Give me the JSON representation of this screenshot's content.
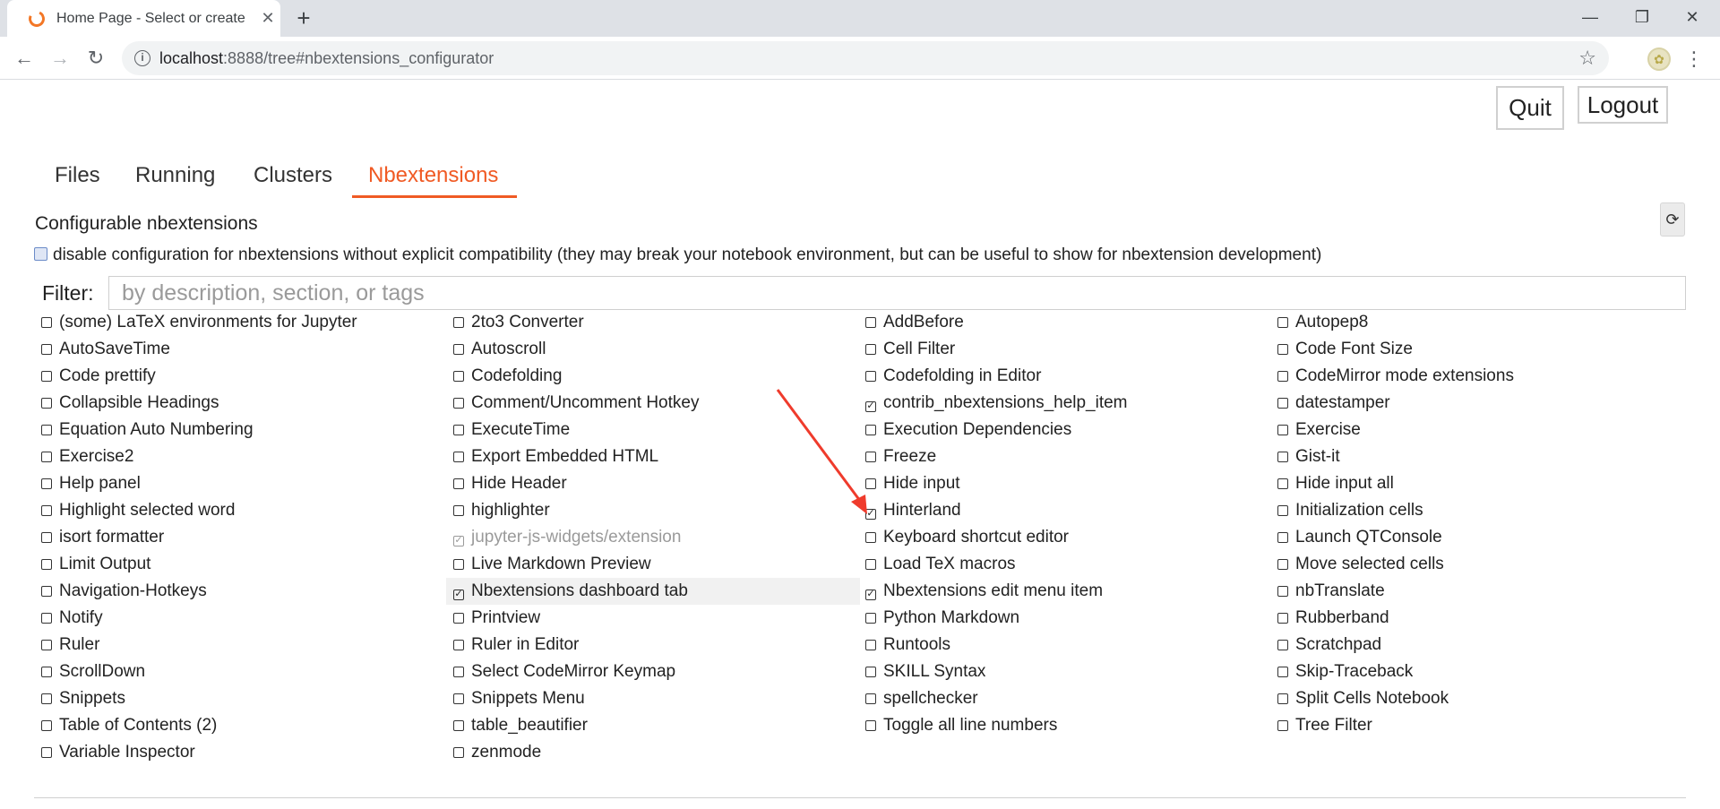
{
  "browser": {
    "tab_title": "Home Page - Select or create a",
    "tab_close": "✕",
    "new_tab": "+",
    "win_minimize": "—",
    "win_restore": "❐",
    "win_close": "✕",
    "url_host": "localhost",
    "url_rest": ":8888/tree#nbextensions_configurator",
    "back": "←",
    "forward": "→",
    "reload": "↻",
    "star": "☆",
    "menu": "⋮",
    "info": "i"
  },
  "header": {
    "quit_label": "Quit",
    "logout_label": "Logout"
  },
  "tabs": [
    {
      "label": "Files"
    },
    {
      "label": "Running"
    },
    {
      "label": "Clusters"
    },
    {
      "label": "Nbextensions"
    }
  ],
  "configurator": {
    "title": "Configurable nbextensions",
    "refresh_icon": "⟳",
    "compat_label": "disable configuration for nbextensions without explicit compatibility (they may break your notebook environment, but can be useful to show for nbextension development)",
    "filter_label": "Filter:",
    "filter_placeholder": "by description, section, or tags"
  },
  "extensions": {
    "columns": [
      [
        {
          "name": "(some) LaTeX environments for Jupyter",
          "checked": false
        },
        {
          "name": "AutoSaveTime",
          "checked": false
        },
        {
          "name": "Code prettify",
          "checked": false
        },
        {
          "name": "Collapsible Headings",
          "checked": false
        },
        {
          "name": "Equation Auto Numbering",
          "checked": false
        },
        {
          "name": "Exercise2",
          "checked": false
        },
        {
          "name": "Help panel",
          "checked": false
        },
        {
          "name": "Highlight selected word",
          "checked": false
        },
        {
          "name": "isort formatter",
          "checked": false
        },
        {
          "name": "Limit Output",
          "checked": false
        },
        {
          "name": "Navigation-Hotkeys",
          "checked": false
        },
        {
          "name": "Notify",
          "checked": false
        },
        {
          "name": "Ruler",
          "checked": false
        },
        {
          "name": "ScrollDown",
          "checked": false
        },
        {
          "name": "Snippets",
          "checked": false
        },
        {
          "name": "Table of Contents (2)",
          "checked": false
        },
        {
          "name": "Variable Inspector",
          "checked": false
        }
      ],
      [
        {
          "name": "2to3 Converter",
          "checked": false
        },
        {
          "name": "Autoscroll",
          "checked": false
        },
        {
          "name": "Codefolding",
          "checked": false
        },
        {
          "name": "Comment/Uncomment Hotkey",
          "checked": false
        },
        {
          "name": "ExecuteTime",
          "checked": false
        },
        {
          "name": "Export Embedded HTML",
          "checked": false
        },
        {
          "name": "Hide Header",
          "checked": false
        },
        {
          "name": "highlighter",
          "checked": false
        },
        {
          "name": "jupyter-js-widgets/extension",
          "checked": true,
          "dim": true
        },
        {
          "name": "Live Markdown Preview",
          "checked": false
        },
        {
          "name": "Nbextensions dashboard tab",
          "checked": true,
          "highlight": true
        },
        {
          "name": "Printview",
          "checked": false
        },
        {
          "name": "Ruler in Editor",
          "checked": false
        },
        {
          "name": "Select CodeMirror Keymap",
          "checked": false
        },
        {
          "name": "Snippets Menu",
          "checked": false
        },
        {
          "name": "table_beautifier",
          "checked": false
        },
        {
          "name": "zenmode",
          "checked": false
        }
      ],
      [
        {
          "name": "AddBefore",
          "checked": false
        },
        {
          "name": "Cell Filter",
          "checked": false
        },
        {
          "name": "Codefolding in Editor",
          "checked": false
        },
        {
          "name": "contrib_nbextensions_help_item",
          "checked": true
        },
        {
          "name": "Execution Dependencies",
          "checked": false
        },
        {
          "name": "Freeze",
          "checked": false
        },
        {
          "name": "Hide input",
          "checked": false
        },
        {
          "name": "Hinterland",
          "checked": true
        },
        {
          "name": "Keyboard shortcut editor",
          "checked": false
        },
        {
          "name": "Load TeX macros",
          "checked": false
        },
        {
          "name": "Nbextensions edit menu item",
          "checked": true
        },
        {
          "name": "Python Markdown",
          "checked": false
        },
        {
          "name": "Runtools",
          "checked": false
        },
        {
          "name": "SKILL Syntax",
          "checked": false
        },
        {
          "name": "spellchecker",
          "checked": false
        },
        {
          "name": "Toggle all line numbers",
          "checked": false
        }
      ],
      [
        {
          "name": "Autopep8",
          "checked": false
        },
        {
          "name": "Code Font Size",
          "checked": false
        },
        {
          "name": "CodeMirror mode extensions",
          "checked": false
        },
        {
          "name": "datestamper",
          "checked": false
        },
        {
          "name": "Exercise",
          "checked": false
        },
        {
          "name": "Gist-it",
          "checked": false
        },
        {
          "name": "Hide input all",
          "checked": false
        },
        {
          "name": "Initialization cells",
          "checked": false
        },
        {
          "name": "Launch QTConsole",
          "checked": false
        },
        {
          "name": "Move selected cells",
          "checked": false
        },
        {
          "name": "nbTranslate",
          "checked": false
        },
        {
          "name": "Rubberband",
          "checked": false
        },
        {
          "name": "Scratchpad",
          "checked": false
        },
        {
          "name": "Skip-Traceback",
          "checked": false
        },
        {
          "name": "Split Cells Notebook",
          "checked": false
        },
        {
          "name": "Tree Filter",
          "checked": false
        }
      ]
    ]
  },
  "annotation": {
    "arrow_color": "#ef3b2c"
  }
}
